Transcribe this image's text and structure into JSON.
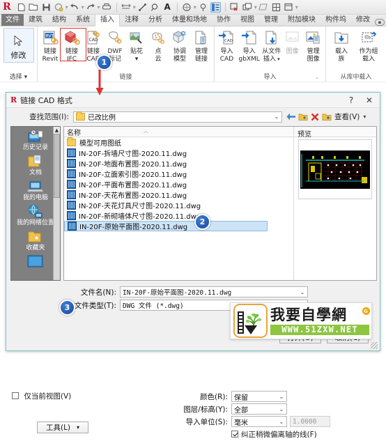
{
  "app": {
    "logo": "R",
    "quick_access": [
      {
        "name": "new-icon",
        "glyph": "▢"
      },
      {
        "name": "open-icon",
        "glyph": "▷"
      },
      {
        "name": "save-icon",
        "glyph": "▣"
      },
      {
        "name": "save-as-icon",
        "glyph": "◌"
      },
      {
        "name": "undo-icon",
        "glyph": "↶"
      },
      {
        "name": "redo-icon",
        "glyph": "↷"
      },
      {
        "name": "print-icon",
        "glyph": "⎙"
      },
      {
        "name": "measure-icon",
        "glyph": "⇌"
      },
      {
        "name": "aligned-dimension-icon",
        "glyph": "⟋"
      },
      {
        "name": "tag-icon",
        "glyph": "⌕"
      },
      {
        "name": "text-icon",
        "glyph": "A"
      },
      {
        "name": "default-3d-view-icon",
        "glyph": "◍"
      },
      {
        "name": "section-icon",
        "glyph": "⌀"
      },
      {
        "name": "thin-lines-icon",
        "glyph": "▤"
      },
      {
        "name": "close-hidden-windows-icon",
        "glyph": "▥"
      },
      {
        "name": "switch-windows-icon",
        "glyph": "❐"
      },
      {
        "name": "visibility-graphics-icon",
        "glyph": "▱"
      },
      {
        "name": "window-icon",
        "glyph": "▦"
      },
      {
        "name": "user-interface-icon",
        "glyph": "▤"
      }
    ],
    "tabs": [
      {
        "label": "文件",
        "state": "file"
      },
      {
        "label": "建筑",
        "state": "normal"
      },
      {
        "label": "结构",
        "state": "normal"
      },
      {
        "label": "系统",
        "state": "normal"
      },
      {
        "label": "插入",
        "state": "active"
      },
      {
        "label": "注释",
        "state": "normal"
      },
      {
        "label": "分析",
        "state": "normal"
      },
      {
        "label": "体量和场地",
        "state": "normal"
      },
      {
        "label": "协作",
        "state": "normal"
      },
      {
        "label": "视图",
        "state": "normal"
      },
      {
        "label": "管理",
        "state": "normal"
      },
      {
        "label": "附加模块",
        "state": "normal"
      },
      {
        "label": "构件坞",
        "state": "normal"
      },
      {
        "label": "修改",
        "state": "normal"
      }
    ],
    "tab_overflow_icon": "overflow-dropdown-icon",
    "panels": [
      {
        "name": "select",
        "title": "选择 ▾",
        "big_button": {
          "label": "修改",
          "icon": "cursor-arrow-icon"
        }
      },
      {
        "name": "link",
        "title": "链接",
        "buttons": [
          {
            "label_top": "链接",
            "label_bottom": "Revit",
            "icon": "link-revit-icon"
          },
          {
            "label_top": "链接",
            "label_bottom": "IFC",
            "icon": "link-ifc-icon"
          },
          {
            "label_top": "链接",
            "label_bottom": "CAD",
            "icon": "link-cad-icon",
            "highlighted": true
          },
          {
            "label_top": "DWF",
            "label_bottom": "标记",
            "icon": "dwf-markup-icon"
          },
          {
            "label_top": "贴花",
            "label_bottom": "▾",
            "icon": "decal-icon"
          },
          {
            "label_top": "点",
            "label_bottom": "云",
            "icon": "point-cloud-icon"
          },
          {
            "label_top": "协调",
            "label_bottom": "模型",
            "icon": "coordination-model-icon"
          },
          {
            "label_top": "管理",
            "label_bottom": "链接",
            "icon": "manage-links-icon"
          }
        ]
      },
      {
        "name": "import",
        "title": "导入",
        "buttons": [
          {
            "label_top": "导入",
            "label_bottom": "CAD",
            "icon": "import-cad-icon"
          },
          {
            "label_top": "导入",
            "label_bottom": "gbXML",
            "icon": "import-gbxml-icon"
          },
          {
            "label_top": "从文件",
            "label_bottom": "插入",
            "icon": "insert-from-file-icon"
          },
          {
            "label_top": "图像",
            "label_bottom": "",
            "icon": "image-icon"
          },
          {
            "label_top": "管理",
            "label_bottom": "图像",
            "icon": "manage-images-icon"
          }
        ]
      },
      {
        "name": "load-from-library",
        "title": "从库中载入",
        "buttons": [
          {
            "label_top": "载入",
            "label_bottom": "族",
            "icon": "load-family-icon"
          },
          {
            "label_top": "作为组",
            "label_bottom": "载入",
            "icon": "load-as-group-icon"
          }
        ]
      }
    ]
  },
  "dialog": {
    "title": "链接 CAD 格式",
    "logo": "R",
    "help_label": "?",
    "close_label": "✕",
    "lookin": {
      "label": "查找范围(I):",
      "value": "已改比例"
    },
    "toolbar": [
      {
        "name": "back-icon",
        "glyph": "⬅"
      },
      {
        "name": "up-one-level-icon",
        "glyph": "📁"
      },
      {
        "name": "delete-icon",
        "glyph": "✕"
      },
      {
        "name": "new-folder-icon",
        "glyph": "📁"
      }
    ],
    "views_label": "查看(V)",
    "places": [
      {
        "label": "历史记录",
        "icon": "history-icon"
      },
      {
        "label": "文档",
        "icon": "documents-icon"
      },
      {
        "label": "我的电脑",
        "icon": "my-computer-icon"
      },
      {
        "label": "我的网络位置",
        "icon": "network-places-icon"
      },
      {
        "label": "收藏夹",
        "icon": "favorites-icon"
      },
      {
        "label": "",
        "icon": "desktop-icon"
      }
    ],
    "file_list": {
      "column_header": "名称",
      "rows": [
        {
          "name": "模型可用图纸",
          "type": "folder",
          "selected": false
        },
        {
          "name": "IN-20F-拆墙尺寸图-2020.11.dwg",
          "type": "dwg",
          "selected": false
        },
        {
          "name": "IN-20F-地面布置图-2020.11.dwg",
          "type": "dwg",
          "selected": false
        },
        {
          "name": "IN-20F-立面索引图-2020.11.dwg",
          "type": "dwg",
          "selected": false
        },
        {
          "name": "IN-20F-平面布置图-2020.11.dwg",
          "type": "dwg",
          "selected": false
        },
        {
          "name": "IN-20F-天花布置图-2020.11.dwg",
          "type": "dwg",
          "selected": false
        },
        {
          "name": "IN-20F-天花灯具尺寸图-2020.11.dwg",
          "type": "dwg",
          "selected": false
        },
        {
          "name": "IN-20F-新砌墙体尺寸图-2020.11.dwg",
          "type": "dwg",
          "selected": false
        },
        {
          "name": "IN-20F-原始平面图-2020.11.dwg",
          "type": "dwg",
          "selected": true
        }
      ]
    },
    "preview": {
      "label": "预览"
    },
    "fields": [
      {
        "label": "文件名(N):",
        "value": "IN-20F-原始平面图-2020.11.dwg",
        "name": "file-name-combo"
      },
      {
        "label": "文件类型(T):",
        "value": "DWG 文件 (*.dwg)",
        "name": "file-type-combo"
      }
    ],
    "options": {
      "current_view_only": {
        "label": "仅当前视图(V)",
        "checked": false
      },
      "rows": [
        {
          "label": "颜色(R):",
          "value": "保留",
          "name": "colors-combo"
        },
        {
          "label": "图层/标高(Y):",
          "value": "全部",
          "name": "layers-combo"
        },
        {
          "label": "导入单位(S):",
          "value": "毫米",
          "name": "import-units-combo"
        }
      ],
      "scale_value": "1.0000",
      "correct_lines": {
        "label": "纠正稍微偏离轴的线(F)",
        "checked": true
      },
      "tools_label": "工具(L)"
    },
    "buttons": [
      {
        "label": "打开(O)",
        "name": "open-button"
      },
      {
        "label": "取消(C)",
        "name": "cancel-button"
      }
    ]
  },
  "annotations": {
    "callouts": [
      {
        "number": "1",
        "target": "link-cad-button"
      },
      {
        "number": "2",
        "target": "selected-file-row"
      },
      {
        "number": "3",
        "target": "current-view-only-checkbox"
      }
    ],
    "arrow": {
      "name": "red-arrow",
      "color": "#e03131"
    },
    "highlight_color": "#e03131"
  },
  "watermark": {
    "title": "我要自學網",
    "url": "WWW.51ZXW.NET",
    "badge": "G"
  }
}
